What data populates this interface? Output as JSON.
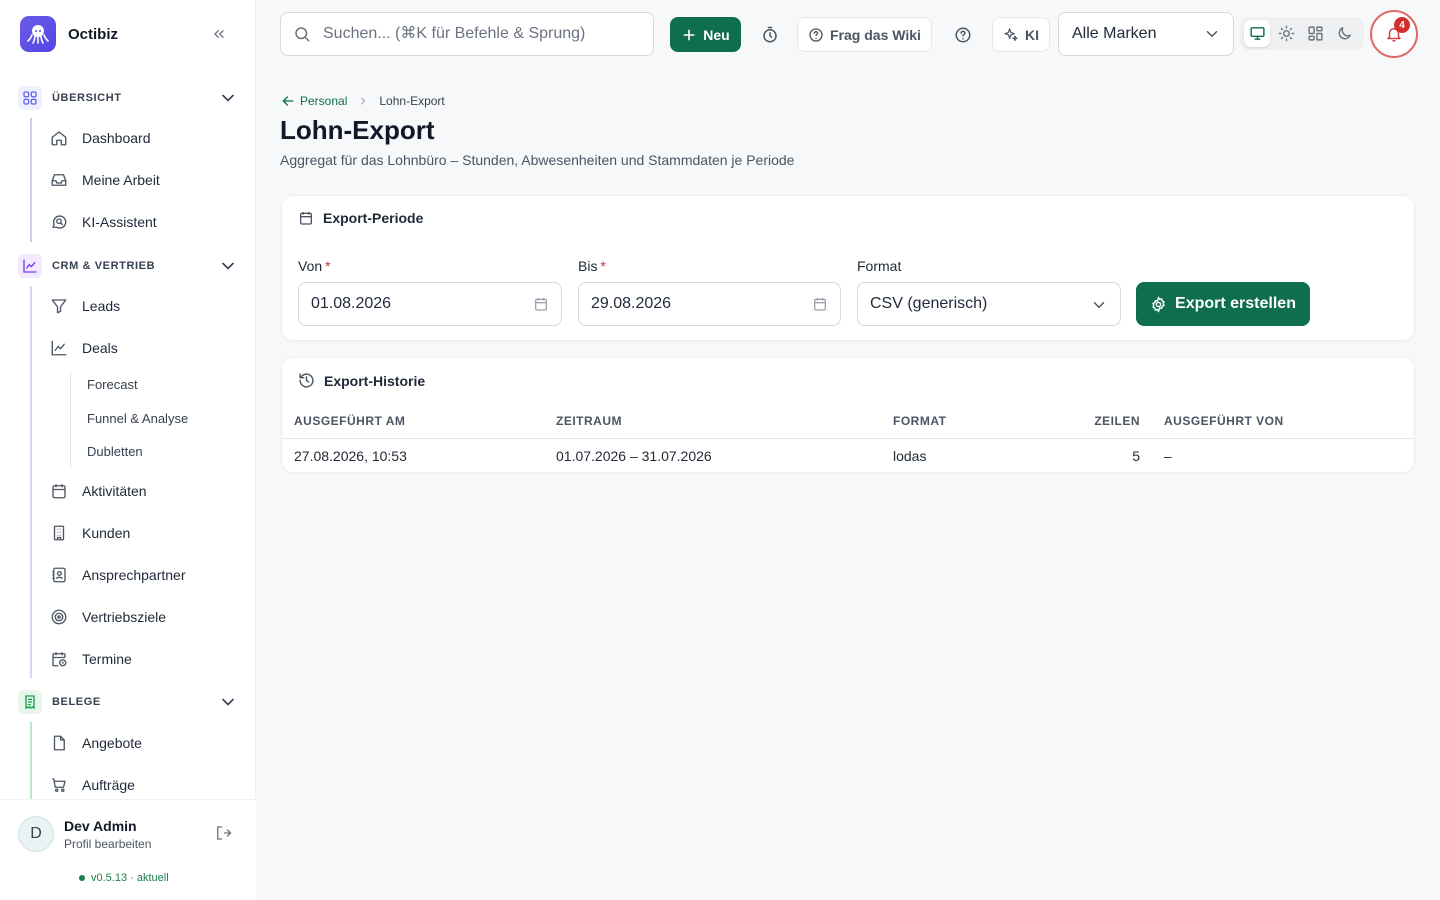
{
  "app": {
    "name": "Octibiz"
  },
  "sidebar": {
    "sections": [
      {
        "label": "ÜBERSICHT",
        "color": "#6366f1"
      },
      {
        "label": "CRM & VERTRIEB",
        "color": "#7c3aed"
      },
      {
        "label": "BELEGE",
        "color": "#16a34a"
      }
    ],
    "items": {
      "dashboard": "Dashboard",
      "meine_arbeit": "Meine Arbeit",
      "ki_assistent": "KI-Assistent",
      "leads": "Leads",
      "deals": "Deals",
      "forecast": "Forecast",
      "funnel": "Funnel & Analyse",
      "dubletten": "Dubletten",
      "aktivitaeten": "Aktivitäten",
      "kunden": "Kunden",
      "ansprechpartner": "Ansprechpartner",
      "vertriebsziele": "Vertriebsziele",
      "termine": "Termine",
      "angebote": "Angebote",
      "auftraege": "Aufträge"
    },
    "user": {
      "initial": "D",
      "name": "Dev Admin",
      "subtitle": "Profil bearbeiten"
    },
    "version": "v0.5.13 · aktuell"
  },
  "topbar": {
    "search_placeholder": "Suchen... (⌘K für Befehle & Sprung)",
    "new_label": "Neu",
    "wiki_label": "Frag das Wiki",
    "ki_label": "KI",
    "brand_select": "Alle Marken",
    "notification_count": "4"
  },
  "page": {
    "breadcrumb_parent": "Personal",
    "breadcrumb_current": "Lohn-Export",
    "title": "Lohn-Export",
    "subtitle": "Aggregat für das Lohnbüro – Stunden, Abwesenheiten und Stammdaten je Periode"
  },
  "export_form": {
    "title": "Export-Periode",
    "from_label": "Von",
    "from_value": "01.08.2026",
    "to_label": "Bis",
    "to_value": "29.08.2026",
    "required_mark": "*",
    "format_label": "Format",
    "format_value": "CSV (generisch)",
    "submit_label": "Export erstellen"
  },
  "history": {
    "title": "Export-Historie",
    "columns": [
      "AUSGEFÜHRT AM",
      "ZEITRAUM",
      "FORMAT",
      "ZEILEN",
      "AUSGEFÜHRT VON"
    ],
    "rows": [
      {
        "executed_at": "27.08.2026, 10:53",
        "period": "01.07.2026 – 31.07.2026",
        "format": "lodas",
        "rows": "5",
        "executed_by": "–"
      }
    ]
  },
  "colors": {
    "accent": "#0f6e4c",
    "alert": "#d32f2f"
  }
}
